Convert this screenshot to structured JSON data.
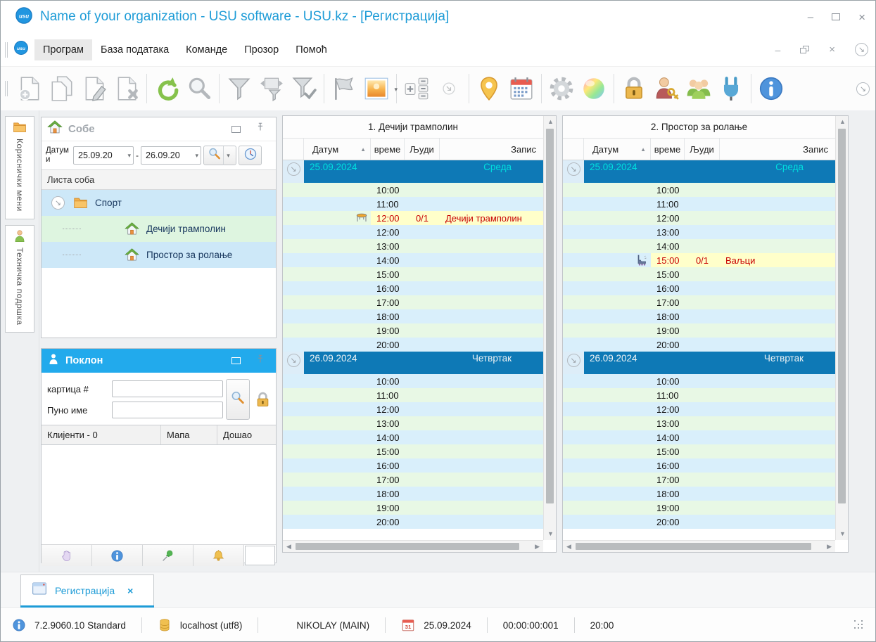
{
  "window": {
    "title": "Name of your organization - USU software - USU.kz - [Регистрација]",
    "controls": {
      "minimize": "–",
      "maximize": "maximize",
      "close": "×"
    }
  },
  "menu": {
    "items": [
      "Програм",
      "База података",
      "Команде",
      "Прозор",
      "Помоћ"
    ],
    "active_item": "Програм"
  },
  "toolbar": {
    "buttons": [
      {
        "name": "add-record",
        "icon": "doc-add-icon"
      },
      {
        "name": "copy-record",
        "icon": "doc-copy-icon"
      },
      {
        "name": "edit-record",
        "icon": "doc-edit-icon"
      },
      {
        "name": "delete-record",
        "icon": "doc-delete-icon",
        "sep_after": true
      },
      {
        "name": "refresh",
        "icon": "refresh-icon"
      },
      {
        "name": "search",
        "icon": "search-icon",
        "sep_after": true
      },
      {
        "name": "filter",
        "icon": "filter-icon"
      },
      {
        "name": "filter-window",
        "icon": "filter-window-icon"
      },
      {
        "name": "filter-apply",
        "icon": "filter-check-icon",
        "sep_after": true
      },
      {
        "name": "flag",
        "icon": "flag-icon"
      },
      {
        "name": "image",
        "icon": "picture-icon",
        "dropdown": true,
        "sep_after": true
      },
      {
        "name": "counters",
        "icon": "counter-icon"
      },
      {
        "name": "expand-more",
        "icon": "circle-arrow-icon",
        "disabled": true,
        "sep_after": true
      },
      {
        "name": "location",
        "icon": "location-icon"
      },
      {
        "name": "calendar",
        "icon": "calendar-icon",
        "sep_after": true
      },
      {
        "name": "settings",
        "icon": "gear-icon"
      },
      {
        "name": "colors",
        "icon": "colors-icon",
        "sep_after": true
      },
      {
        "name": "lock",
        "icon": "lock-icon"
      },
      {
        "name": "user-access",
        "icon": "user-key-icon"
      },
      {
        "name": "user-groups",
        "icon": "users-icon"
      },
      {
        "name": "integration",
        "icon": "plug-icon",
        "sep_after": true
      },
      {
        "name": "info",
        "icon": "info-icon"
      }
    ]
  },
  "side_tabs": [
    {
      "label": "Кориснички мени",
      "icon": "folder-icon"
    },
    {
      "label": "Техничка подршка",
      "icon": "person-icon"
    }
  ],
  "rooms": {
    "title": "Собе",
    "date_label": "Датуми",
    "date_from": "25.09.20",
    "date_to": "26.09.20",
    "list_header": "Листа соба",
    "tree": [
      {
        "label": "Спорт",
        "icon": "folder-icon",
        "bg": "blue",
        "expandable": true
      },
      {
        "label": "Дечији трамполин",
        "icon": "house-icon",
        "bg": "green",
        "child": true
      },
      {
        "label": "Простор за ролање",
        "icon": "house-icon",
        "bg": "blue",
        "child": true
      }
    ]
  },
  "gift": {
    "title": "Поклон",
    "fields": [
      {
        "label": "картица #",
        "value": ""
      },
      {
        "label": "Пуно име",
        "value": ""
      }
    ],
    "table_headers": [
      "Клијенти - 0",
      "Мапа",
      "Дошао"
    ],
    "footer_icons": [
      "hand-icon",
      "info-icon",
      "pin-green-icon",
      "bell-icon"
    ]
  },
  "schedules": [
    {
      "title": "1. Дечији трамполин",
      "columns": {
        "date": "Датум",
        "time": "време",
        "people": "Људи",
        "record": "Запис"
      },
      "sections": [
        {
          "date": "25.09.2024",
          "weekday": "Среда",
          "current": true,
          "rows": [
            {
              "time": "10:00"
            },
            {
              "time": "11:00"
            },
            {
              "time": "12:00",
              "people": "0/1",
              "record": "Дечији трамполин",
              "booked": true,
              "icon": "trampoline-icon"
            },
            {
              "time": "12:00"
            },
            {
              "time": "13:00"
            },
            {
              "time": "14:00"
            },
            {
              "time": "15:00"
            },
            {
              "time": "16:00"
            },
            {
              "time": "17:00"
            },
            {
              "time": "18:00"
            },
            {
              "time": "19:00"
            },
            {
              "time": "20:00"
            }
          ]
        },
        {
          "date": "26.09.2024",
          "weekday": "Четвртак",
          "rows": [
            {
              "time": "10:00"
            },
            {
              "time": "11:00"
            },
            {
              "time": "12:00"
            },
            {
              "time": "13:00"
            },
            {
              "time": "14:00"
            },
            {
              "time": "15:00"
            },
            {
              "time": "16:00"
            },
            {
              "time": "17:00"
            },
            {
              "time": "18:00"
            },
            {
              "time": "19:00"
            },
            {
              "time": "20:00"
            }
          ]
        }
      ]
    },
    {
      "title": "2. Простор за ролање",
      "columns": {
        "date": "Датум",
        "time": "време",
        "people": "Људи",
        "record": "Запис"
      },
      "sections": [
        {
          "date": "25.09.2024",
          "weekday": "Среда",
          "current": true,
          "rows": [
            {
              "time": "10:00"
            },
            {
              "time": "11:00"
            },
            {
              "time": "12:00"
            },
            {
              "time": "13:00"
            },
            {
              "time": "14:00"
            },
            {
              "time": "15:00",
              "people": "0/1",
              "record": "Ваљци",
              "booked": true,
              "icon": "skate-icon"
            },
            {
              "time": "15:00"
            },
            {
              "time": "16:00"
            },
            {
              "time": "17:00"
            },
            {
              "time": "18:00"
            },
            {
              "time": "19:00"
            },
            {
              "time": "20:00"
            }
          ]
        },
        {
          "date": "26.09.2024",
          "weekday": "Четвртак",
          "rows": [
            {
              "time": "10:00"
            },
            {
              "time": "11:00"
            },
            {
              "time": "12:00"
            },
            {
              "time": "13:00"
            },
            {
              "time": "14:00"
            },
            {
              "time": "15:00"
            },
            {
              "time": "16:00"
            },
            {
              "time": "17:00"
            },
            {
              "time": "18:00"
            },
            {
              "time": "19:00"
            },
            {
              "time": "20:00"
            }
          ]
        }
      ]
    }
  ],
  "doc_tab": {
    "label": "Регистрација",
    "close": "×"
  },
  "statusbar": {
    "items": [
      {
        "icon": "info-icon",
        "text": "7.2.9060.10 Standard"
      },
      {
        "icon": "database-icon",
        "text": "localhost (utf8)"
      },
      {
        "icon": "user-icon",
        "text": "NIKOLAY (MAIN)"
      },
      {
        "icon": "calendar-31-icon",
        "text": "25.09.2024"
      },
      {
        "text": "00:00:00:001"
      },
      {
        "text": "20:00"
      }
    ]
  },
  "colors": {
    "accent_blue": "#1e9cd7",
    "panel_header_blue": "#22aaec",
    "date_row_bg": "#0e79b6",
    "date_text_current": "#00dede",
    "date_text_other": "#edf2f4",
    "row_green": "#e8f8e5",
    "row_blue": "#d9effb",
    "booked_bg": "#ffffca",
    "booked_text": "#c80000",
    "tree_blue": "#cde8f8",
    "tree_green": "#def5e0",
    "date_gutter_bg": "#ddedf8"
  }
}
